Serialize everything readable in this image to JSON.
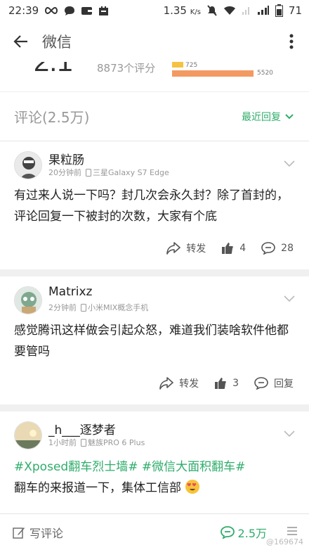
{
  "status_bar": {
    "time": "22:39",
    "speed_value": "1.35",
    "speed_unit": "K/s",
    "battery": "71"
  },
  "app_bar": {
    "title": "微信"
  },
  "rating": {
    "score": "2.1",
    "count_text": "8873个评分",
    "bar_small_value": "725",
    "bar_large_value": "5520"
  },
  "comments_header": {
    "title": "评论(2.5万)",
    "sort_label": "最近回复"
  },
  "comments": [
    {
      "name": "果粒肠",
      "time": "20分钟前",
      "device": "三星Galaxy S7 Edge",
      "text": "有过来人说一下吗？封几次会永久封？除了首封的，评论回复一下被封的次数，大家有个底",
      "share_label": "转发",
      "likes": "4",
      "replies": "28"
    },
    {
      "name": "Matrixz",
      "time": "2分钟前",
      "device": "小米MIX概念手机",
      "text": "感觉腾讯这样做会引起众怒，难道我们装啥软件他都要管吗",
      "share_label": "转发",
      "likes": "3",
      "replies": "回复"
    },
    {
      "name": "_h___逐梦者",
      "time": "1小时前",
      "device": "魅族PRO 6 Plus",
      "tags": "#Xposed翻车烈士墙# #微信大面积翻车#",
      "text": "翻车的来报道一下，集体工信部"
    }
  ],
  "bottom_bar": {
    "write_label": "写评论",
    "comment_count": "2.5万"
  },
  "watermark": "@169674"
}
